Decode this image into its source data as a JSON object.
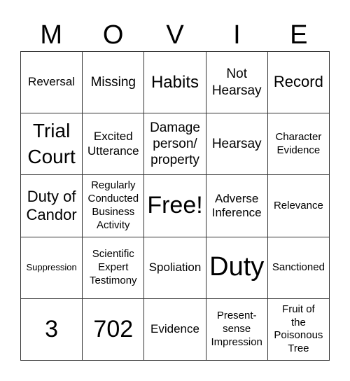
{
  "header": [
    "M",
    "O",
    "V",
    "I",
    "E"
  ],
  "cells": [
    [
      "Reversal",
      "Missing",
      "Habits",
      "Not Hearsay",
      "Record"
    ],
    [
      "Trial Court",
      "Excited Utterance",
      "Damage person/ property",
      "Hearsay",
      "Character Evidence"
    ],
    [
      "Duty of Candor",
      "Regularly Conducted Business Activity",
      "Free!",
      "Adverse Inference",
      "Relevance"
    ],
    [
      "Suppression",
      "Scientific Expert Testimony",
      "Spoliation",
      "Duty",
      "Sanctioned"
    ],
    [
      "3",
      "702",
      "Evidence",
      "Present-sense Impression",
      "Fruit of the Poisonous Tree"
    ]
  ]
}
